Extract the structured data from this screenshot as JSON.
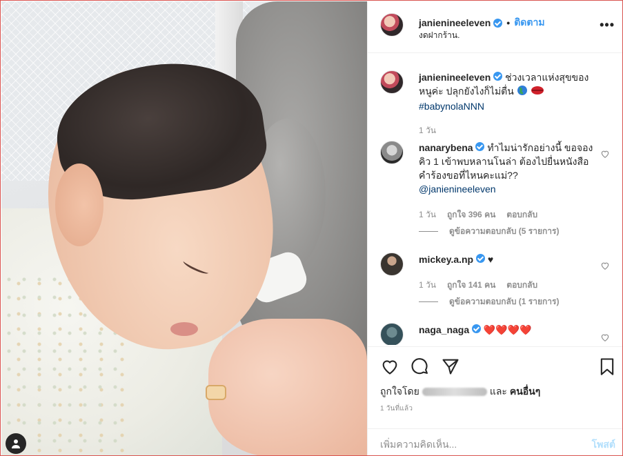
{
  "post": {
    "username": "janienineeleven",
    "follow_label": "ติดตาม",
    "separator": "•",
    "location": "งดฝากร้าน.",
    "more_label": "•••"
  },
  "caption": {
    "username": "janienineeleven",
    "text": "ช่วงเวลาแห่งสุขของหนูค่ะ ปลุกยังไงก็ไม่ตื่น",
    "hashtag": "#babynolaNNN",
    "time": "1 วัน"
  },
  "comments": [
    {
      "username": "nanarybena",
      "text": "ทำไมน่ารักอย่างนี้ ขอจองคิว 1 เข้าพบหลานโนล่า ต้องไปยื่นหนังสือคำร้องขอที่ไหนคะแม่??",
      "mention": "@janienineeleven",
      "time": "1 วัน",
      "likes": "ถูกใจ 396 คน",
      "reply_label": "ตอบกลับ",
      "view_replies": "ดูข้อความตอบกลับ (5 รายการ)"
    },
    {
      "username": "mickey.a.np",
      "text": "♥",
      "time": "1 วัน",
      "likes": "ถูกใจ 141 คน",
      "reply_label": "ตอบกลับ",
      "view_replies": "ดูข้อความตอบกลับ (1 รายการ)"
    },
    {
      "username": "naga_naga",
      "text": "❤️❤️❤️❤️"
    }
  ],
  "actions": {
    "liked_by_prefix": "ถูกใจโดย",
    "liked_by_suffix": "และ",
    "others": "คนอื่นๆ",
    "posted_ago": "1 วันที่แล้ว",
    "comment_placeholder": "เพิ่มความคิดเห็น...",
    "post_button": "โพสต์"
  },
  "icons": {
    "heart": "heart-icon",
    "comment": "comment-icon",
    "share": "paper-plane-icon",
    "save": "bookmark-icon",
    "verified": "verified-badge-icon",
    "user": "user-icon"
  },
  "colors": {
    "accent": "#3897f0",
    "muted": "#8e8e8e",
    "post_disabled": "#b2dffc",
    "mention": "#00376b",
    "border": "#efefef"
  }
}
